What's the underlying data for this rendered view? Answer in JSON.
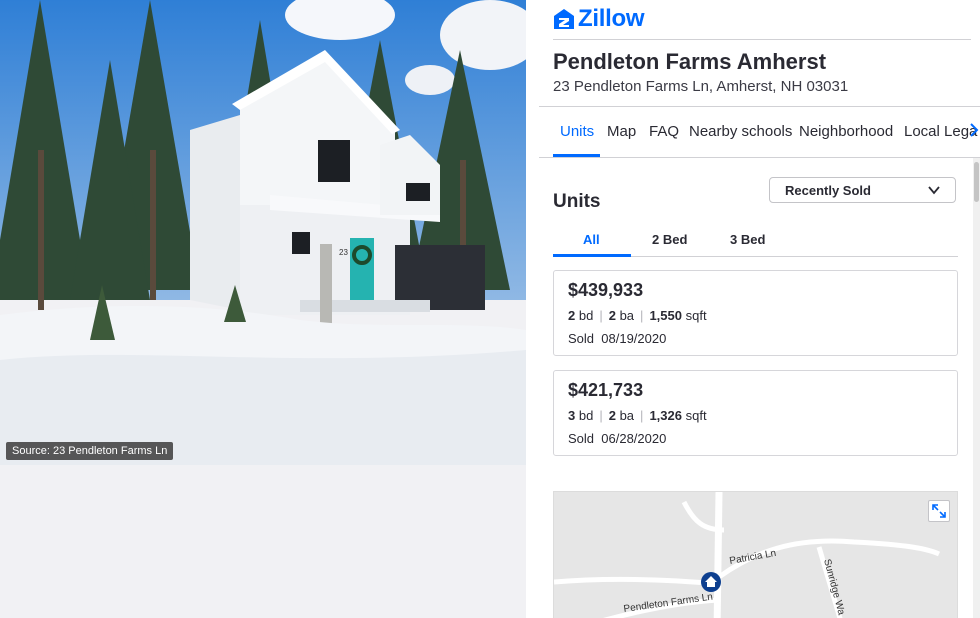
{
  "photo": {
    "source_label": "Source: 23 Pendleton Farms Ln",
    "house_number": "23"
  },
  "brand": {
    "name": "Zillow",
    "color": "#006aff"
  },
  "property": {
    "title": "Pendleton Farms Amherst",
    "address": "23 Pendleton Farms Ln, Amherst, NH 03031"
  },
  "tabs": [
    {
      "label": "Units",
      "active": true
    },
    {
      "label": "Map"
    },
    {
      "label": "FAQ"
    },
    {
      "label": "Nearby schools"
    },
    {
      "label": "Neighborhood"
    },
    {
      "label": "Local Lega"
    }
  ],
  "tabs_more_icon": "chevron-right-icon",
  "units": {
    "heading": "Units",
    "filter": {
      "selected": "Recently Sold",
      "icon": "chevron-down-icon"
    },
    "bed_tabs": [
      {
        "label": "All",
        "active": true
      },
      {
        "label": "2 Bed"
      },
      {
        "label": "3 Bed"
      }
    ],
    "listings": [
      {
        "price": "$439,933",
        "beds": "2",
        "beds_unit": "bd",
        "baths": "2",
        "baths_unit": "ba",
        "sqft": "1,550",
        "sqft_unit": "sqft",
        "status": "Sold",
        "date": "08/19/2020"
      },
      {
        "price": "$421,733",
        "beds": "3",
        "beds_unit": "bd",
        "baths": "2",
        "baths_unit": "ba",
        "sqft": "1,326",
        "sqft_unit": "sqft",
        "status": "Sold",
        "date": "06/28/2020"
      }
    ]
  },
  "map": {
    "labels": {
      "road1": "Patricia Ln",
      "road2": "Pendleton Farms Ln",
      "road3": "Sunridge Wa"
    },
    "marker_icon": "home-marker-icon",
    "expand_icon": "expand-icon"
  }
}
